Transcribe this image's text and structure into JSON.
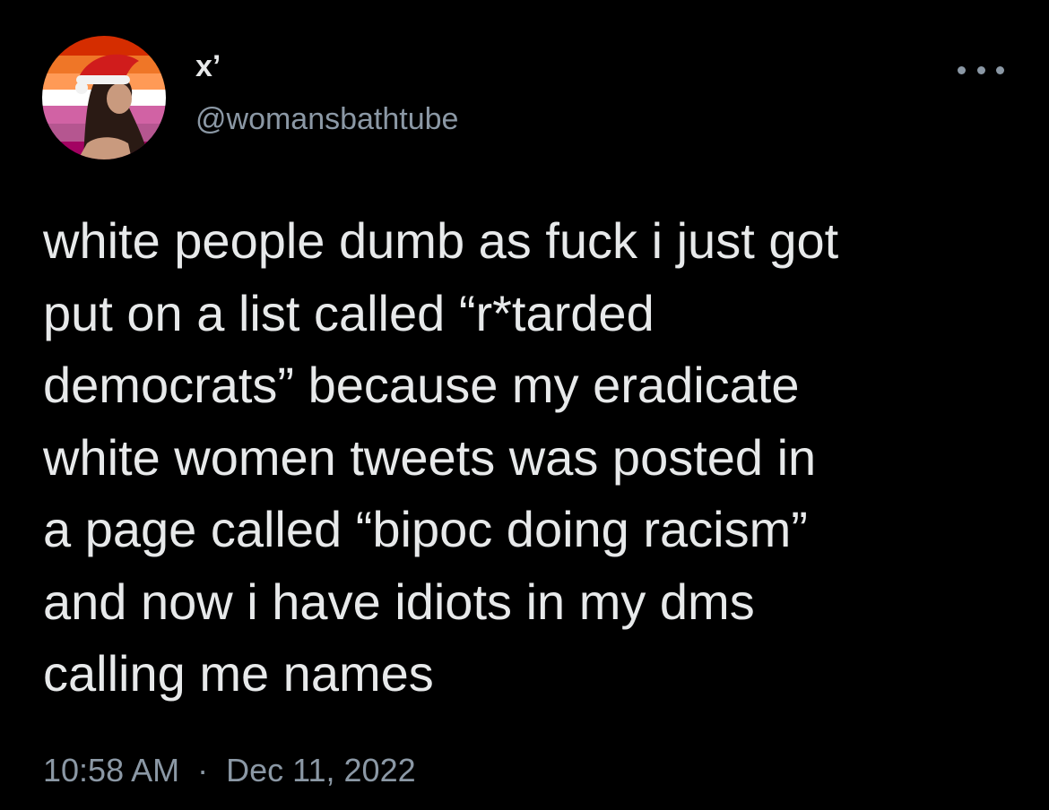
{
  "tweet": {
    "author": {
      "display_name": "x’",
      "handle": "@womansbathtube",
      "avatar_icon": "avatar-santa-hat-pride-flag"
    },
    "more_icon": "more-options-icon",
    "text": "white people dumb as fuck i just got\nput on a list called “r*tarded\ndemocrats” because my eradicate\nwhite women tweets was posted in\na page called “bipoc doing racism”\nand now i have idiots in my dms\ncalling me names",
    "time": "10:58 AM",
    "separator": "·",
    "date": "Dec 11, 2022"
  },
  "colors": {
    "background": "#000000",
    "primary_text": "#e7e9ea",
    "secondary_text": "#8b98a5",
    "flag_stripes": [
      "#d52d00",
      "#ef7627",
      "#ff9a56",
      "#ffffff",
      "#d162a4",
      "#b55690",
      "#a30262"
    ]
  }
}
